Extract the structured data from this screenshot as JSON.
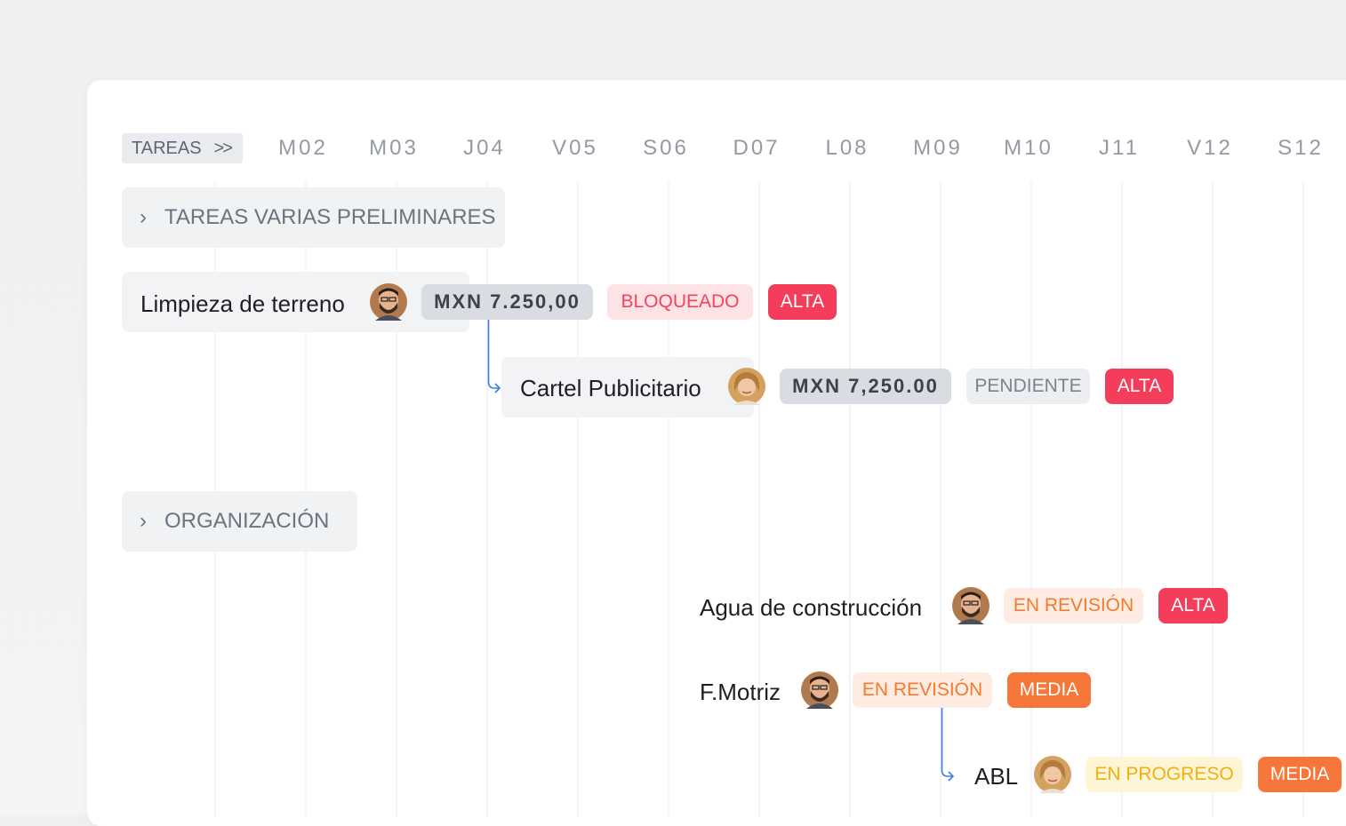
{
  "header": {
    "tasks_label": "TAREAS",
    "expand_icon": "double-chevron-right-icon",
    "days": [
      "M02",
      "M03",
      "J04",
      "V05",
      "S06",
      "D07",
      "L08",
      "M09",
      "M10",
      "J11",
      "V12",
      "S12"
    ]
  },
  "groups": [
    {
      "label": "TAREAS VARIAS PRELIMINARES",
      "icon": "chevron-right-icon"
    },
    {
      "label": "ORGANIZACIÓN",
      "icon": "chevron-right-icon"
    }
  ],
  "tasks": [
    {
      "name": "Limpieza de terreno",
      "avatar": "man-avatar",
      "amount": "MXN 7.250,00",
      "status": "BLOQUEADO",
      "priority": "ALTA"
    },
    {
      "name": "Cartel Publicitario",
      "avatar": "woman-avatar",
      "amount": "MXN 7,250.00",
      "status": "PENDIENTE",
      "priority": "ALTA"
    },
    {
      "name": "Agua de construcción",
      "avatar": "man-avatar",
      "status": "EN REVISIÓN",
      "priority": "ALTA"
    },
    {
      "name": "F.Motriz",
      "avatar": "man-avatar",
      "status": "EN REVISIÓN",
      "priority": "MEDIA"
    },
    {
      "name": "ABL",
      "avatar": "woman-avatar",
      "status": "EN PROGRESO",
      "priority": "MEDIA"
    }
  ],
  "colors": {
    "alta": "#f43d5a",
    "media": "#f67739",
    "bloqueado": "#f2445e",
    "en_revision": "#f47a2c",
    "en_progreso": "#f0b10d",
    "dependency_line": "#3b7be8"
  }
}
